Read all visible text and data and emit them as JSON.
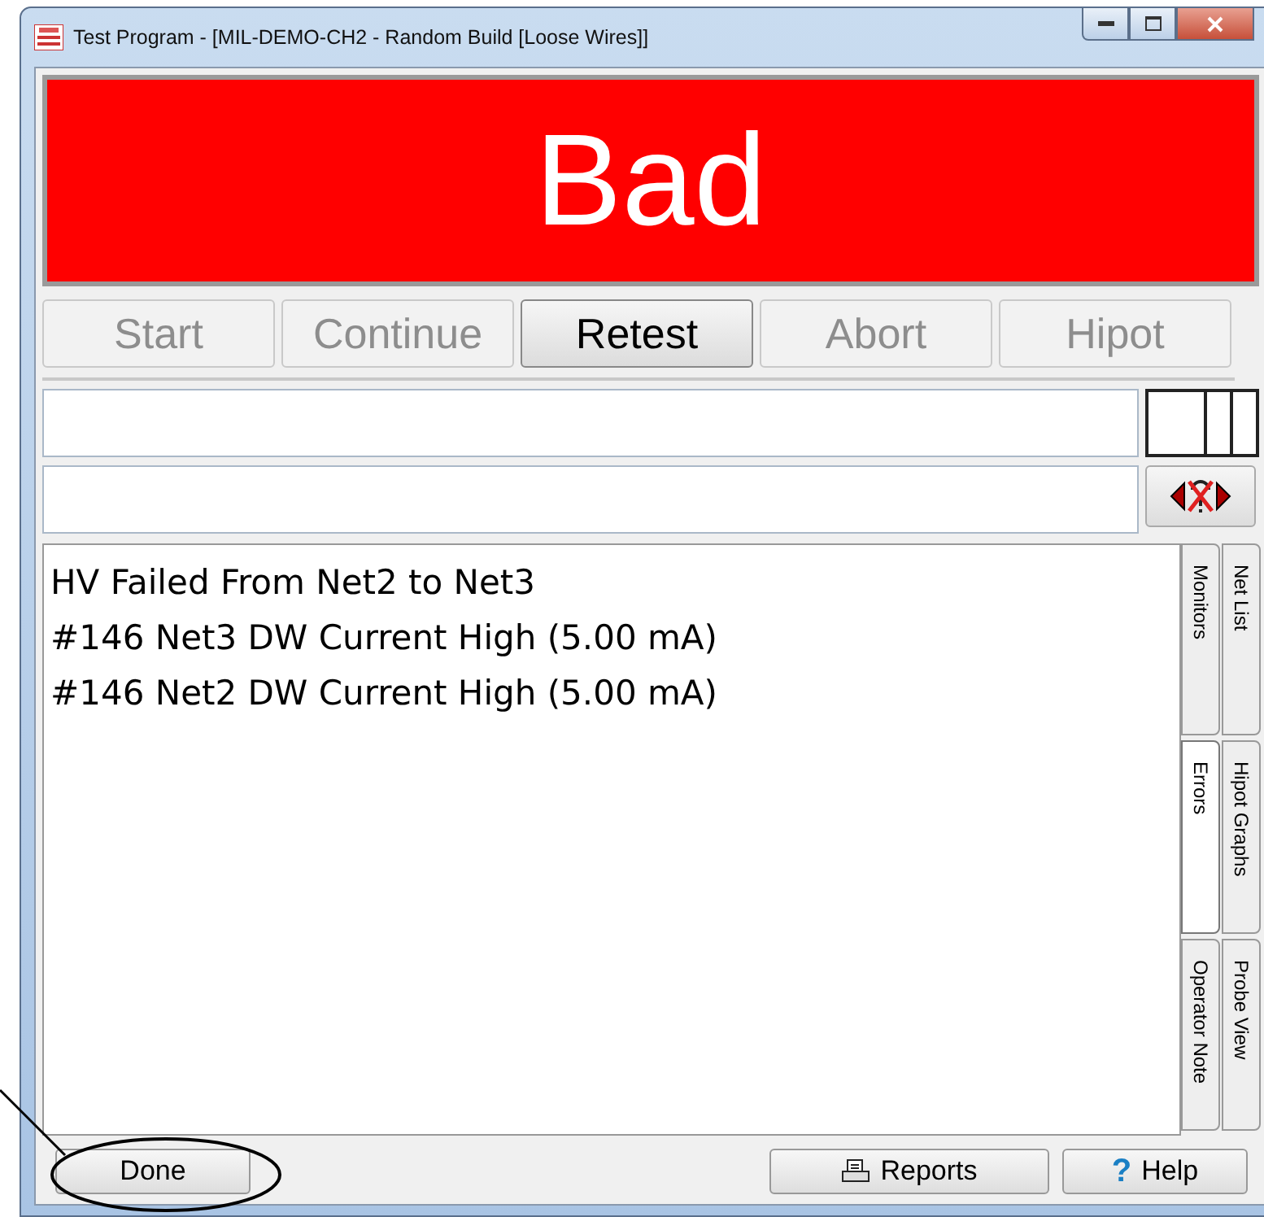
{
  "window": {
    "title": "Test Program - [MIL-DEMO-CH2 - Random Build [Loose Wires]]"
  },
  "status": {
    "text": "Bad",
    "color": "#ff0000"
  },
  "actions": [
    {
      "label": "Start",
      "disabled": true
    },
    {
      "label": "Continue",
      "disabled": true
    },
    {
      "label": "Retest",
      "disabled": false
    },
    {
      "label": "Abort",
      "disabled": true
    },
    {
      "label": "Hipot",
      "disabled": true
    }
  ],
  "messages": [
    "HV Failed From Net2 to Net3",
    "#146 Net3 DW Current High (5.00 mA)",
    "#146 Net2 DW Current High (5.00 mA)"
  ],
  "side_tabs": {
    "inner": [
      {
        "label": "Monitors",
        "selected": false
      },
      {
        "label": "Errors",
        "selected": true
      },
      {
        "label": "Operator Note",
        "selected": false
      }
    ],
    "outer": [
      {
        "label": "Net List",
        "selected": false
      },
      {
        "label": "Hipot Graphs",
        "selected": false
      },
      {
        "label": "Probe View",
        "selected": false
      }
    ]
  },
  "footer": {
    "done": "Done",
    "reports": "Reports",
    "help_icon": "?",
    "help": "Help"
  }
}
